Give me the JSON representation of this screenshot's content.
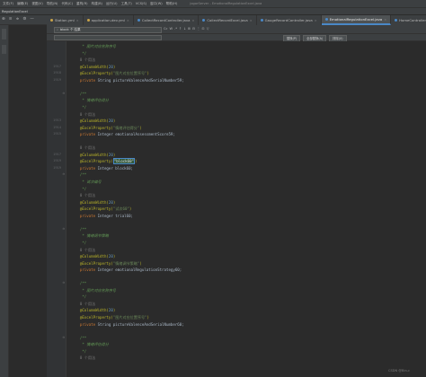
{
  "menubar": {
    "items": [
      "文件(F)",
      "编辑(E)",
      "视图(V)",
      "导航(N)",
      "代码(C)",
      "重构(R)",
      "构建(B)",
      "运行(U)",
      "工具(T)",
      "VCS(S)",
      "窗口(W)",
      "帮助(H)"
    ],
    "title": "jogorServer - EmotionalRegulationExcel.java"
  },
  "breadcrumb": {
    "path": "RegulationExcel"
  },
  "toolbar": {
    "icons": [
      "globe-icon",
      "align-icon",
      "collapse-icon",
      "settings-icon",
      "minus-icon"
    ],
    "icon_glyphs": [
      "⊕",
      "≡",
      "≑",
      "⚙",
      "—"
    ]
  },
  "tabs": [
    {
      "label": "Station.yml",
      "color": "#c9a44a",
      "active": false
    },
    {
      "label": "application-dev.yml",
      "color": "#c9a44a",
      "active": false
    },
    {
      "label": "CollectRecordController.java",
      "color": "#4a88c7",
      "active": false
    },
    {
      "label": "CollectRecordExcel.java",
      "color": "#4a88c7",
      "active": false
    },
    {
      "label": "GaugeRecordController.java",
      "color": "#4a88c7",
      "active": false
    },
    {
      "label": "EmotionalRegulationExcel.java",
      "color": "#4a88c7",
      "active": true
    },
    {
      "label": "HomeController.java",
      "color": "#4a88c7",
      "active": false
    }
  ],
  "search": {
    "value": "block 个 结果",
    "tool_glyphs": [
      "Cc",
      "W",
      ".*",
      "↑",
      "↓",
      "⊞",
      "⊟",
      "⋮",
      "⊡",
      "▽"
    ]
  },
  "replace": {
    "value": "block",
    "buttons": [
      "替换(P)",
      "全部替换(A)",
      "排除(X)"
    ]
  },
  "editor": {
    "lines": [
      {
        "n": "",
        "kind": "doccomment",
        "text": "     * 图片对应名称序号"
      },
      {
        "n": "",
        "kind": "doccomment",
        "text": "     */"
      },
      {
        "n": "",
        "kind": "hint",
        "text": "    0 个用法"
      },
      {
        "n": "1917",
        "kind": "anno_num",
        "a": "    @ColumnWidth(",
        "b": "20",
        "c": ")"
      },
      {
        "n": "1918",
        "kind": "anno_str",
        "a": "    @ExcelProperty(",
        "b": "\"图片对应位置序号\"",
        "c": ")"
      },
      {
        "n": "1919",
        "kind": "decl",
        "kw": "    private ",
        "rest": "String pictureValenceAndSerialNumber59;"
      },
      {
        "n": "",
        "kind": "plain",
        "text": ""
      },
      {
        "n": "",
        "kind": "doccomment",
        "text": "    /**"
      },
      {
        "n": "",
        "kind": "doccomment",
        "text": "     * 情绪评估得分"
      },
      {
        "n": "",
        "kind": "doccomment",
        "text": "     */"
      },
      {
        "n": "",
        "kind": "hint",
        "text": "    0 个用法"
      },
      {
        "n": "1913",
        "kind": "anno_num",
        "a": "    @ColumnWidth(",
        "b": "20",
        "c": ")"
      },
      {
        "n": "1914",
        "kind": "anno_str",
        "a": "    @ExcelProperty(",
        "b": "\"情绪评估得分\"",
        "c": ")"
      },
      {
        "n": "1915",
        "kind": "decl",
        "kw": "    private ",
        "rest": "Integer emotionalAssessmentScore59;"
      },
      {
        "n": "",
        "kind": "plain",
        "text": ""
      },
      {
        "n": "",
        "kind": "hint",
        "text": "    0 个用法"
      },
      {
        "n": "1917",
        "kind": "anno_num",
        "a": "    @ColumnWidth(",
        "b": "20",
        "c": ")"
      },
      {
        "n": "1919",
        "kind": "anno_match",
        "a": "    @ExcelProperty(",
        "b": "\"block60\"",
        "c": ")"
      },
      {
        "n": "1919",
        "kind": "decl",
        "kw": "    private ",
        "rest": "Integer block60;"
      },
      {
        "n": "",
        "kind": "doccomment",
        "text": "    /**"
      },
      {
        "n": "",
        "kind": "doccomment",
        "text": "     * 试次编号"
      },
      {
        "n": "",
        "kind": "doccomment",
        "text": "     */"
      },
      {
        "n": "",
        "kind": "hint",
        "text": "    0 个用法"
      },
      {
        "n": "",
        "kind": "anno_num",
        "a": "    @ColumnWidth(",
        "b": "20",
        "c": ")"
      },
      {
        "n": "",
        "kind": "anno_str",
        "a": "    @ExcelProperty(",
        "b": "\"试次60\"",
        "c": ")"
      },
      {
        "n": "",
        "kind": "decl",
        "kw": "    private ",
        "rest": "Integer trial60;"
      },
      {
        "n": "",
        "kind": "plain",
        "text": ""
      },
      {
        "n": "",
        "kind": "doccomment",
        "text": "    /**"
      },
      {
        "n": "",
        "kind": "doccomment",
        "text": "     * 情绪调节策略"
      },
      {
        "n": "",
        "kind": "doccomment",
        "text": "     */"
      },
      {
        "n": "",
        "kind": "hint",
        "text": "    0 个用法"
      },
      {
        "n": "",
        "kind": "anno_num",
        "a": "    @ColumnWidth(",
        "b": "20",
        "c": ")"
      },
      {
        "n": "",
        "kind": "anno_str",
        "a": "    @ExcelProperty(",
        "b": "\"情绪调节策略\"",
        "c": ")"
      },
      {
        "n": "",
        "kind": "decl",
        "kw": "    private ",
        "rest": "Integer emotionalRegulationStrategy60;"
      },
      {
        "n": "",
        "kind": "plain",
        "text": ""
      },
      {
        "n": "",
        "kind": "doccomment",
        "text": "    /**"
      },
      {
        "n": "",
        "kind": "doccomment",
        "text": "     * 图片对应名称序号"
      },
      {
        "n": "",
        "kind": "doccomment",
        "text": "     */"
      },
      {
        "n": "",
        "kind": "hint",
        "text": "    0 个用法"
      },
      {
        "n": "",
        "kind": "anno_num",
        "a": "    @ColumnWidth(",
        "b": "20",
        "c": ")"
      },
      {
        "n": "",
        "kind": "anno_str",
        "a": "    @ExcelProperty(",
        "b": "\"图片对应位置序号\"",
        "c": ")"
      },
      {
        "n": "",
        "kind": "decl",
        "kw": "    private ",
        "rest": "String pictureValenceAndSerialNumber60;"
      },
      {
        "n": "",
        "kind": "plain",
        "text": ""
      },
      {
        "n": "",
        "kind": "doccomment",
        "text": "    /**"
      },
      {
        "n": "",
        "kind": "doccomment",
        "text": "     * 情绪评估得分"
      },
      {
        "n": "",
        "kind": "doccomment",
        "text": "     */"
      },
      {
        "n": "",
        "kind": "hint",
        "text": "    0 个用法"
      }
    ],
    "current_line_index": 17
  },
  "watermark": "CSDN @Bin-c"
}
